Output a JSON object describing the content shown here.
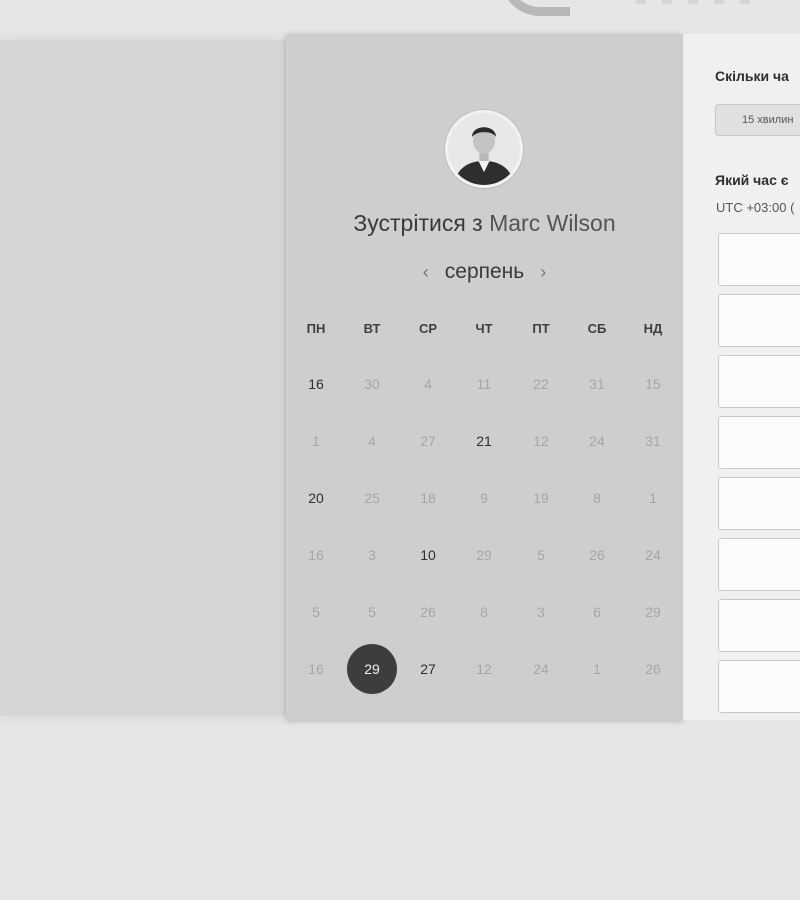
{
  "meeting": {
    "title_prefix": "Зустрітися з",
    "host_name": "Marc Wilson"
  },
  "calendar": {
    "month": "серпень",
    "prev_icon": "‹",
    "next_icon": "›",
    "weekdays": [
      "ПН",
      "ВТ",
      "СР",
      "ЧТ",
      "ПТ",
      "СБ",
      "НД"
    ],
    "rows": [
      [
        {
          "d": "16",
          "a": true
        },
        {
          "d": "30"
        },
        {
          "d": "4"
        },
        {
          "d": "11"
        },
        {
          "d": "22"
        },
        {
          "d": "31"
        },
        {
          "d": "15"
        }
      ],
      [
        {
          "d": "1"
        },
        {
          "d": "4"
        },
        {
          "d": "27"
        },
        {
          "d": "21",
          "a": true
        },
        {
          "d": "12"
        },
        {
          "d": "24"
        },
        {
          "d": "31"
        }
      ],
      [
        {
          "d": "20",
          "a": true
        },
        {
          "d": "25"
        },
        {
          "d": "18"
        },
        {
          "d": "9"
        },
        {
          "d": "19"
        },
        {
          "d": "8"
        },
        {
          "d": "1"
        }
      ],
      [
        {
          "d": "16"
        },
        {
          "d": "3"
        },
        {
          "d": "10",
          "a": true
        },
        {
          "d": "29"
        },
        {
          "d": "5"
        },
        {
          "d": "26"
        },
        {
          "d": "24"
        }
      ],
      [
        {
          "d": "5"
        },
        {
          "d": "5"
        },
        {
          "d": "26"
        },
        {
          "d": "8"
        },
        {
          "d": "3"
        },
        {
          "d": "6"
        },
        {
          "d": "29"
        }
      ],
      [
        {
          "d": "16"
        },
        {
          "d": "29",
          "a": true,
          "s": true
        },
        {
          "d": "27",
          "a": true
        },
        {
          "d": "12"
        },
        {
          "d": "24"
        },
        {
          "d": "1"
        },
        {
          "d": "26"
        }
      ]
    ]
  },
  "right_panel": {
    "duration_question": "Скільки ча",
    "duration_option": "15 хвилин",
    "time_question": "Який час є",
    "timezone": "UTC +03:00 (",
    "slot_count": 8
  },
  "icons": {
    "avatar": "host-avatar-photo",
    "prev": "chevron-left-icon",
    "next": "chevron-right-icon"
  }
}
